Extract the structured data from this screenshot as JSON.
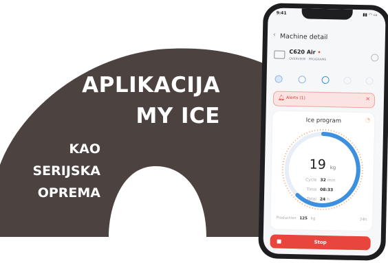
{
  "banner": {
    "line1": "APLIKACIJA",
    "line2": "MY ICE",
    "sub1": "KAO",
    "sub2": "SERIJSKA",
    "sub3": "OPREMA",
    "color": "#4c4341"
  },
  "phone": {
    "status_time": "9:41",
    "status_icons": "▮▮ ◠ ▭",
    "nav_title": "Machine detail",
    "machine": {
      "name": "C620 Air",
      "sub": "OVERVIEW · PROGRAMS"
    },
    "alert": {
      "text": "Alerts (1)",
      "color": "#e8453c"
    },
    "program": {
      "title": "Ice program",
      "value": "19",
      "unit": "kg",
      "progress": 0.62,
      "stats": [
        {
          "label": "Cycle",
          "value": "32",
          "unit": "min"
        },
        {
          "label": "Time",
          "value": "08:33",
          "unit": ""
        },
        {
          "label": "Total",
          "value": "24",
          "unit": "h"
        }
      ],
      "footer_left": "Production",
      "footer_value": "125",
      "footer_unit": "kg",
      "footer_right": "24h"
    },
    "stop_label": "Stop",
    "accent": "#3d8fe0"
  }
}
